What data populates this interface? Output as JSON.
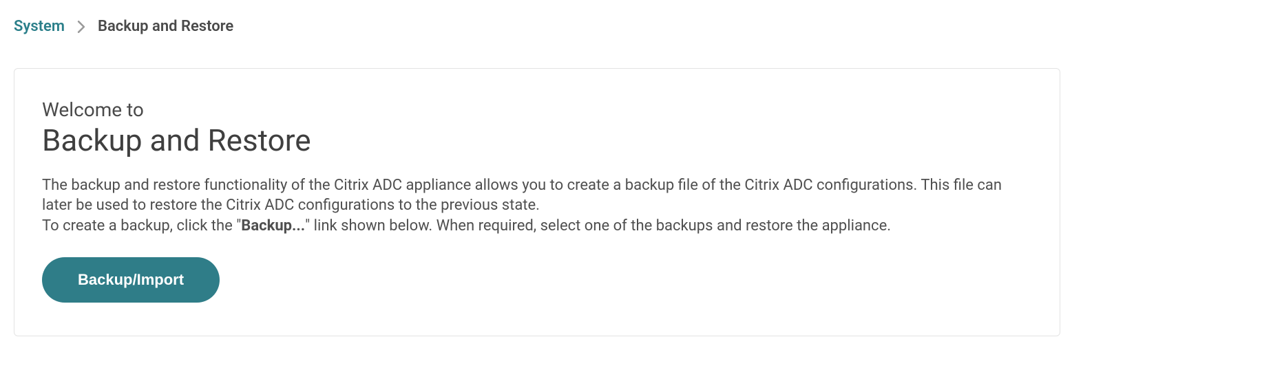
{
  "breadcrumb": {
    "root": "System",
    "current": "Backup and Restore"
  },
  "welcome": {
    "prefix": "Welcome to",
    "title": "Backup and Restore"
  },
  "description": {
    "line1": "The backup and restore functionality of the Citrix ADC appliance allows you to create a backup file of the Citrix ADC configurations. This file can later be used to restore the Citrix ADC configurations to the previous state.",
    "line2_before": "To create a backup, click the \"",
    "line2_bold": "Backup...",
    "line2_after": "\" link shown below. When required, select one of the backups and restore the appliance."
  },
  "buttons": {
    "backup_import": "Backup/Import"
  }
}
